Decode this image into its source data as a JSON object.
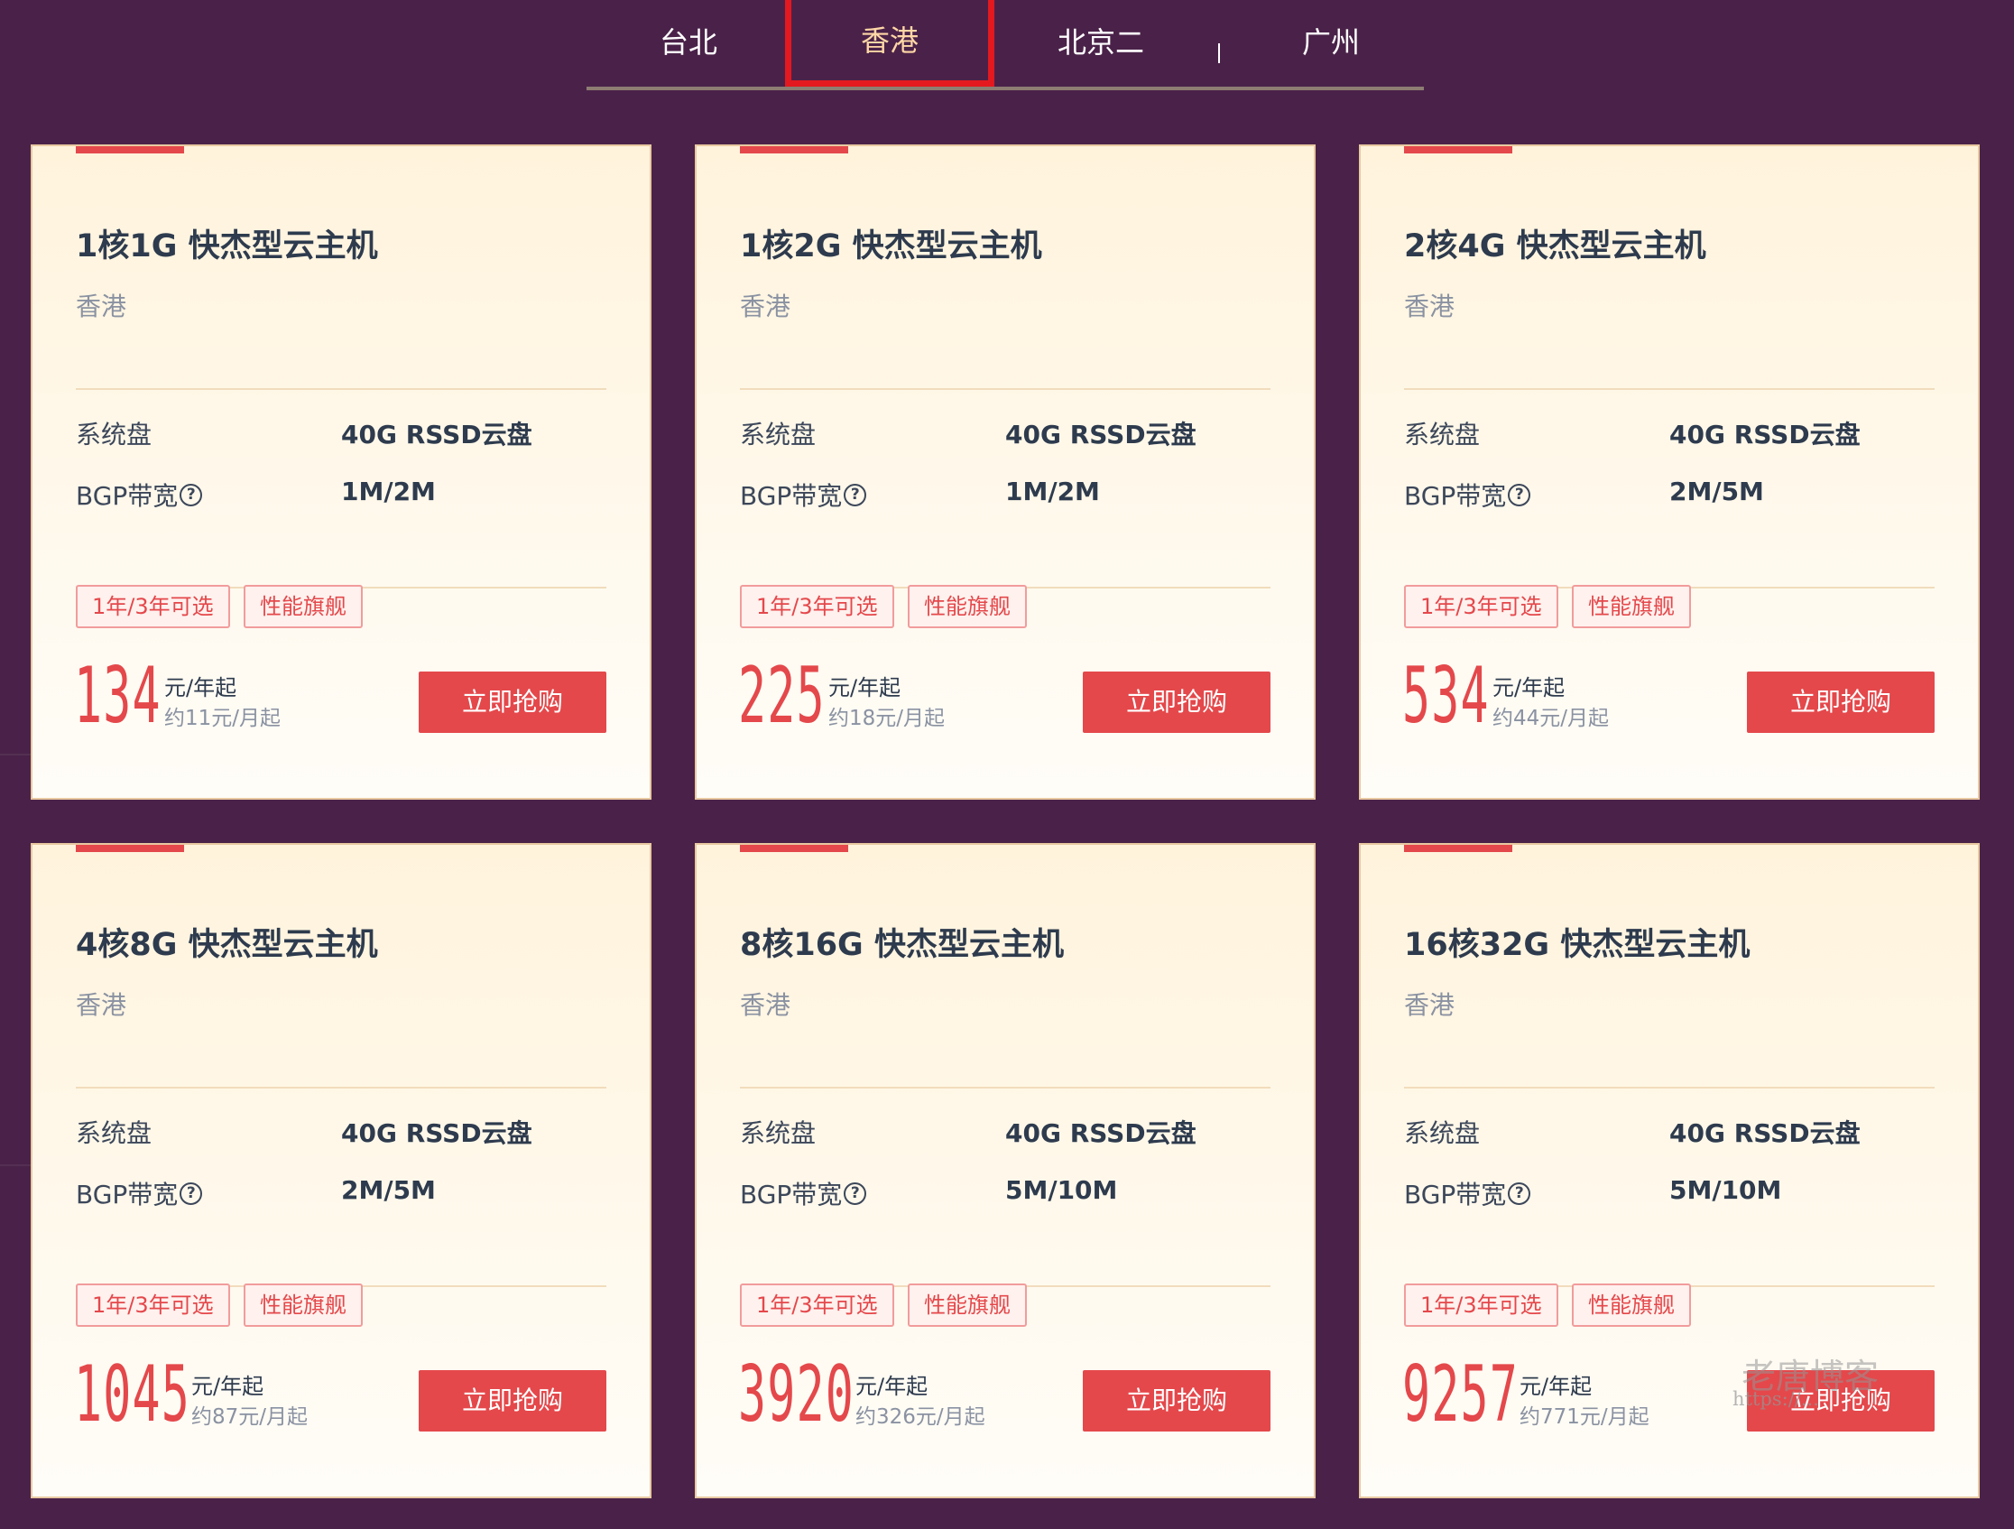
{
  "region_tabs": [
    {
      "label": "台北"
    },
    {
      "label": "香港",
      "active": true
    },
    {
      "label": "北京二"
    },
    {
      "label": "广州"
    }
  ],
  "spec_labels": {
    "disk": "系统盘",
    "bandwidth": "BGP带宽",
    "help_glyph": "?"
  },
  "tags": [
    "1年/3年可选",
    "性能旗舰"
  ],
  "price_unit": "元/年起",
  "buy_label": "立即抢购",
  "cards": [
    {
      "title": "1核1G 快杰型云主机",
      "region": "香港",
      "disk": "40G RSSD云盘",
      "bandwidth": "1M/2M",
      "price": "134",
      "monthly": "约11元/月起"
    },
    {
      "title": "1核2G 快杰型云主机",
      "region": "香港",
      "disk": "40G RSSD云盘",
      "bandwidth": "1M/2M",
      "price": "225",
      "monthly": "约18元/月起"
    },
    {
      "title": "2核4G 快杰型云主机",
      "region": "香港",
      "disk": "40G RSSD云盘",
      "bandwidth": "2M/5M",
      "price": "534",
      "monthly": "约44元/月起"
    },
    {
      "title": "4核8G 快杰型云主机",
      "region": "香港",
      "disk": "40G RSSD云盘",
      "bandwidth": "2M/5M",
      "price": "1045",
      "monthly": "约87元/月起"
    },
    {
      "title": "8核16G 快杰型云主机",
      "region": "香港",
      "disk": "40G RSSD云盘",
      "bandwidth": "5M/10M",
      "price": "3920",
      "monthly": "约326元/月起"
    },
    {
      "title": "16核32G 快杰型云主机",
      "region": "香港",
      "disk": "40G RSSD云盘",
      "bandwidth": "5M/10M",
      "price": "9257",
      "monthly": "约771元/月起"
    }
  ],
  "watermark": {
    "text": "老唐博客",
    "url": "https://..."
  },
  "colors": {
    "background": "#4a2249",
    "accent": "#e4484b",
    "active_tab": "#ffd7a6"
  }
}
